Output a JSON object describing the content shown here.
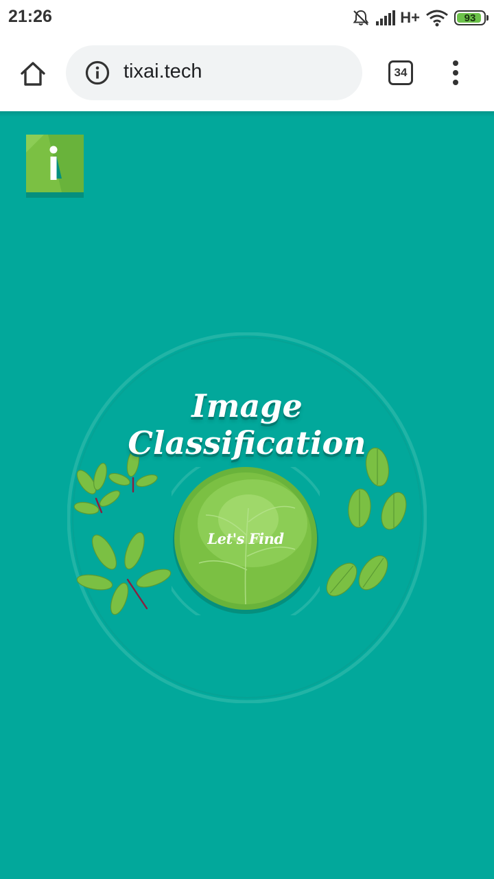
{
  "status_bar": {
    "time": "21:26",
    "network_label": "H+",
    "battery_level": "93",
    "icons": [
      "bell-muted-icon",
      "signal-icon",
      "wifi-icon",
      "battery-icon"
    ]
  },
  "toolbar": {
    "url": "tixai.tech",
    "tab_count": "34",
    "icons": [
      "home-icon",
      "info-icon",
      "tabs-icon",
      "more-vert-icon"
    ]
  },
  "page": {
    "background_color": "#02a89b",
    "logo_icon": "tixai-logo-icon",
    "title": "Image Classification",
    "cta_label": "Let's Find",
    "accent_color": "#7bc043"
  }
}
